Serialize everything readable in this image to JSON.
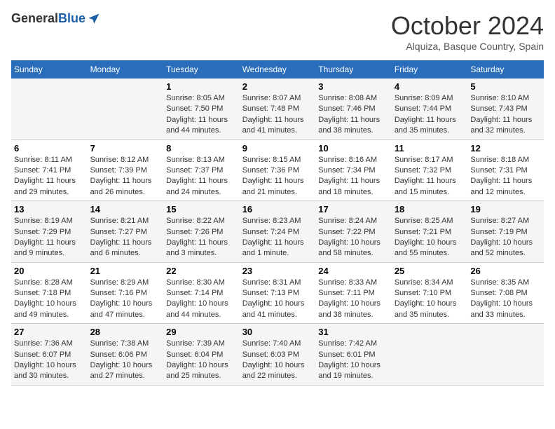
{
  "header": {
    "logo_general": "General",
    "logo_blue": "Blue",
    "month_title": "October 2024",
    "subtitle": "Alquiza, Basque Country, Spain"
  },
  "weekdays": [
    "Sunday",
    "Monday",
    "Tuesday",
    "Wednesday",
    "Thursday",
    "Friday",
    "Saturday"
  ],
  "weeks": [
    [
      {
        "day": "",
        "sunrise": "",
        "sunset": "",
        "daylight": ""
      },
      {
        "day": "",
        "sunrise": "",
        "sunset": "",
        "daylight": ""
      },
      {
        "day": "1",
        "sunrise": "Sunrise: 8:05 AM",
        "sunset": "Sunset: 7:50 PM",
        "daylight": "Daylight: 11 hours and 44 minutes."
      },
      {
        "day": "2",
        "sunrise": "Sunrise: 8:07 AM",
        "sunset": "Sunset: 7:48 PM",
        "daylight": "Daylight: 11 hours and 41 minutes."
      },
      {
        "day": "3",
        "sunrise": "Sunrise: 8:08 AM",
        "sunset": "Sunset: 7:46 PM",
        "daylight": "Daylight: 11 hours and 38 minutes."
      },
      {
        "day": "4",
        "sunrise": "Sunrise: 8:09 AM",
        "sunset": "Sunset: 7:44 PM",
        "daylight": "Daylight: 11 hours and 35 minutes."
      },
      {
        "day": "5",
        "sunrise": "Sunrise: 8:10 AM",
        "sunset": "Sunset: 7:43 PM",
        "daylight": "Daylight: 11 hours and 32 minutes."
      }
    ],
    [
      {
        "day": "6",
        "sunrise": "Sunrise: 8:11 AM",
        "sunset": "Sunset: 7:41 PM",
        "daylight": "Daylight: 11 hours and 29 minutes."
      },
      {
        "day": "7",
        "sunrise": "Sunrise: 8:12 AM",
        "sunset": "Sunset: 7:39 PM",
        "daylight": "Daylight: 11 hours and 26 minutes."
      },
      {
        "day": "8",
        "sunrise": "Sunrise: 8:13 AM",
        "sunset": "Sunset: 7:37 PM",
        "daylight": "Daylight: 11 hours and 24 minutes."
      },
      {
        "day": "9",
        "sunrise": "Sunrise: 8:15 AM",
        "sunset": "Sunset: 7:36 PM",
        "daylight": "Daylight: 11 hours and 21 minutes."
      },
      {
        "day": "10",
        "sunrise": "Sunrise: 8:16 AM",
        "sunset": "Sunset: 7:34 PM",
        "daylight": "Daylight: 11 hours and 18 minutes."
      },
      {
        "day": "11",
        "sunrise": "Sunrise: 8:17 AM",
        "sunset": "Sunset: 7:32 PM",
        "daylight": "Daylight: 11 hours and 15 minutes."
      },
      {
        "day": "12",
        "sunrise": "Sunrise: 8:18 AM",
        "sunset": "Sunset: 7:31 PM",
        "daylight": "Daylight: 11 hours and 12 minutes."
      }
    ],
    [
      {
        "day": "13",
        "sunrise": "Sunrise: 8:19 AM",
        "sunset": "Sunset: 7:29 PM",
        "daylight": "Daylight: 11 hours and 9 minutes."
      },
      {
        "day": "14",
        "sunrise": "Sunrise: 8:21 AM",
        "sunset": "Sunset: 7:27 PM",
        "daylight": "Daylight: 11 hours and 6 minutes."
      },
      {
        "day": "15",
        "sunrise": "Sunrise: 8:22 AM",
        "sunset": "Sunset: 7:26 PM",
        "daylight": "Daylight: 11 hours and 3 minutes."
      },
      {
        "day": "16",
        "sunrise": "Sunrise: 8:23 AM",
        "sunset": "Sunset: 7:24 PM",
        "daylight": "Daylight: 11 hours and 1 minute."
      },
      {
        "day": "17",
        "sunrise": "Sunrise: 8:24 AM",
        "sunset": "Sunset: 7:22 PM",
        "daylight": "Daylight: 10 hours and 58 minutes."
      },
      {
        "day": "18",
        "sunrise": "Sunrise: 8:25 AM",
        "sunset": "Sunset: 7:21 PM",
        "daylight": "Daylight: 10 hours and 55 minutes."
      },
      {
        "day": "19",
        "sunrise": "Sunrise: 8:27 AM",
        "sunset": "Sunset: 7:19 PM",
        "daylight": "Daylight: 10 hours and 52 minutes."
      }
    ],
    [
      {
        "day": "20",
        "sunrise": "Sunrise: 8:28 AM",
        "sunset": "Sunset: 7:18 PM",
        "daylight": "Daylight: 10 hours and 49 minutes."
      },
      {
        "day": "21",
        "sunrise": "Sunrise: 8:29 AM",
        "sunset": "Sunset: 7:16 PM",
        "daylight": "Daylight: 10 hours and 47 minutes."
      },
      {
        "day": "22",
        "sunrise": "Sunrise: 8:30 AM",
        "sunset": "Sunset: 7:14 PM",
        "daylight": "Daylight: 10 hours and 44 minutes."
      },
      {
        "day": "23",
        "sunrise": "Sunrise: 8:31 AM",
        "sunset": "Sunset: 7:13 PM",
        "daylight": "Daylight: 10 hours and 41 minutes."
      },
      {
        "day": "24",
        "sunrise": "Sunrise: 8:33 AM",
        "sunset": "Sunset: 7:11 PM",
        "daylight": "Daylight: 10 hours and 38 minutes."
      },
      {
        "day": "25",
        "sunrise": "Sunrise: 8:34 AM",
        "sunset": "Sunset: 7:10 PM",
        "daylight": "Daylight: 10 hours and 35 minutes."
      },
      {
        "day": "26",
        "sunrise": "Sunrise: 8:35 AM",
        "sunset": "Sunset: 7:08 PM",
        "daylight": "Daylight: 10 hours and 33 minutes."
      }
    ],
    [
      {
        "day": "27",
        "sunrise": "Sunrise: 7:36 AM",
        "sunset": "Sunset: 6:07 PM",
        "daylight": "Daylight: 10 hours and 30 minutes."
      },
      {
        "day": "28",
        "sunrise": "Sunrise: 7:38 AM",
        "sunset": "Sunset: 6:06 PM",
        "daylight": "Daylight: 10 hours and 27 minutes."
      },
      {
        "day": "29",
        "sunrise": "Sunrise: 7:39 AM",
        "sunset": "Sunset: 6:04 PM",
        "daylight": "Daylight: 10 hours and 25 minutes."
      },
      {
        "day": "30",
        "sunrise": "Sunrise: 7:40 AM",
        "sunset": "Sunset: 6:03 PM",
        "daylight": "Daylight: 10 hours and 22 minutes."
      },
      {
        "day": "31",
        "sunrise": "Sunrise: 7:42 AM",
        "sunset": "Sunset: 6:01 PM",
        "daylight": "Daylight: 10 hours and 19 minutes."
      },
      {
        "day": "",
        "sunrise": "",
        "sunset": "",
        "daylight": ""
      },
      {
        "day": "",
        "sunrise": "",
        "sunset": "",
        "daylight": ""
      }
    ]
  ]
}
